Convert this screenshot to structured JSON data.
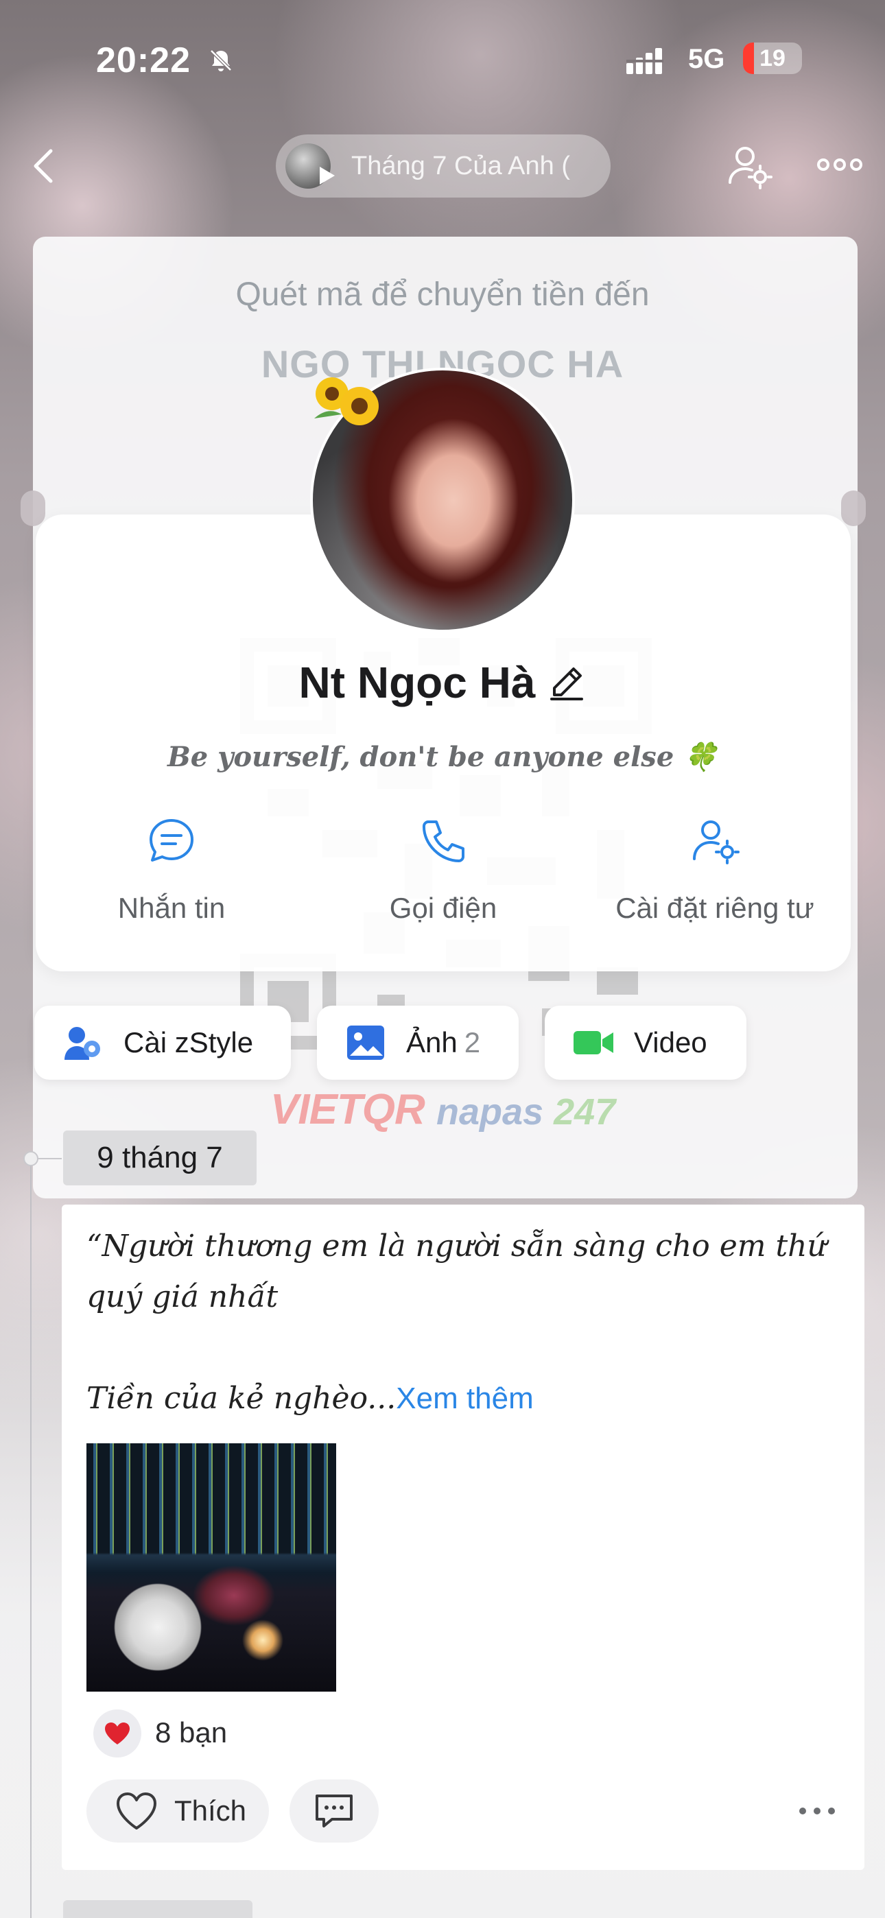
{
  "status_bar": {
    "time": "20:22",
    "network": "5G",
    "battery": "19",
    "battery_level": 0.19
  },
  "nav": {
    "music_title": "Tháng 7 Của Anh ("
  },
  "qr": {
    "line1": "Quét mã để chuyển tiền đến",
    "line2": "NGO THI NGOC HA",
    "brand1": "VIETQR",
    "brand2a": "napas",
    "brand2b": "247"
  },
  "profile": {
    "name": "Nt Ngọc Hà",
    "bio": "Be yourself, don't be anyone else",
    "bio_emoji": "🍀",
    "actions": [
      {
        "label": "Nhắn tin",
        "icon": "chat-bubble-icon"
      },
      {
        "label": "Gọi điện",
        "icon": "phone-icon"
      },
      {
        "label": "Cài đặt riêng tư",
        "icon": "user-settings-icon"
      }
    ]
  },
  "chips": {
    "zstyle": "Cài zStyle",
    "photos": "Ảnh",
    "photos_count": "2",
    "video": "Video"
  },
  "timeline": {
    "date": "9 tháng 7",
    "post": {
      "text": "“Người thương em là người sẵn sàng cho em thứ quý giá nhất\n\nTiền của kẻ nghèo...",
      "more": "Xem thêm",
      "reaction_emoji": "❤️",
      "reaction_count": "8 bạn",
      "like_label": "Thích"
    }
  },
  "colors": {
    "accent": "#2a86e6",
    "chip_video": "#34c759",
    "zstyle_blue": "#2f6fe0"
  }
}
